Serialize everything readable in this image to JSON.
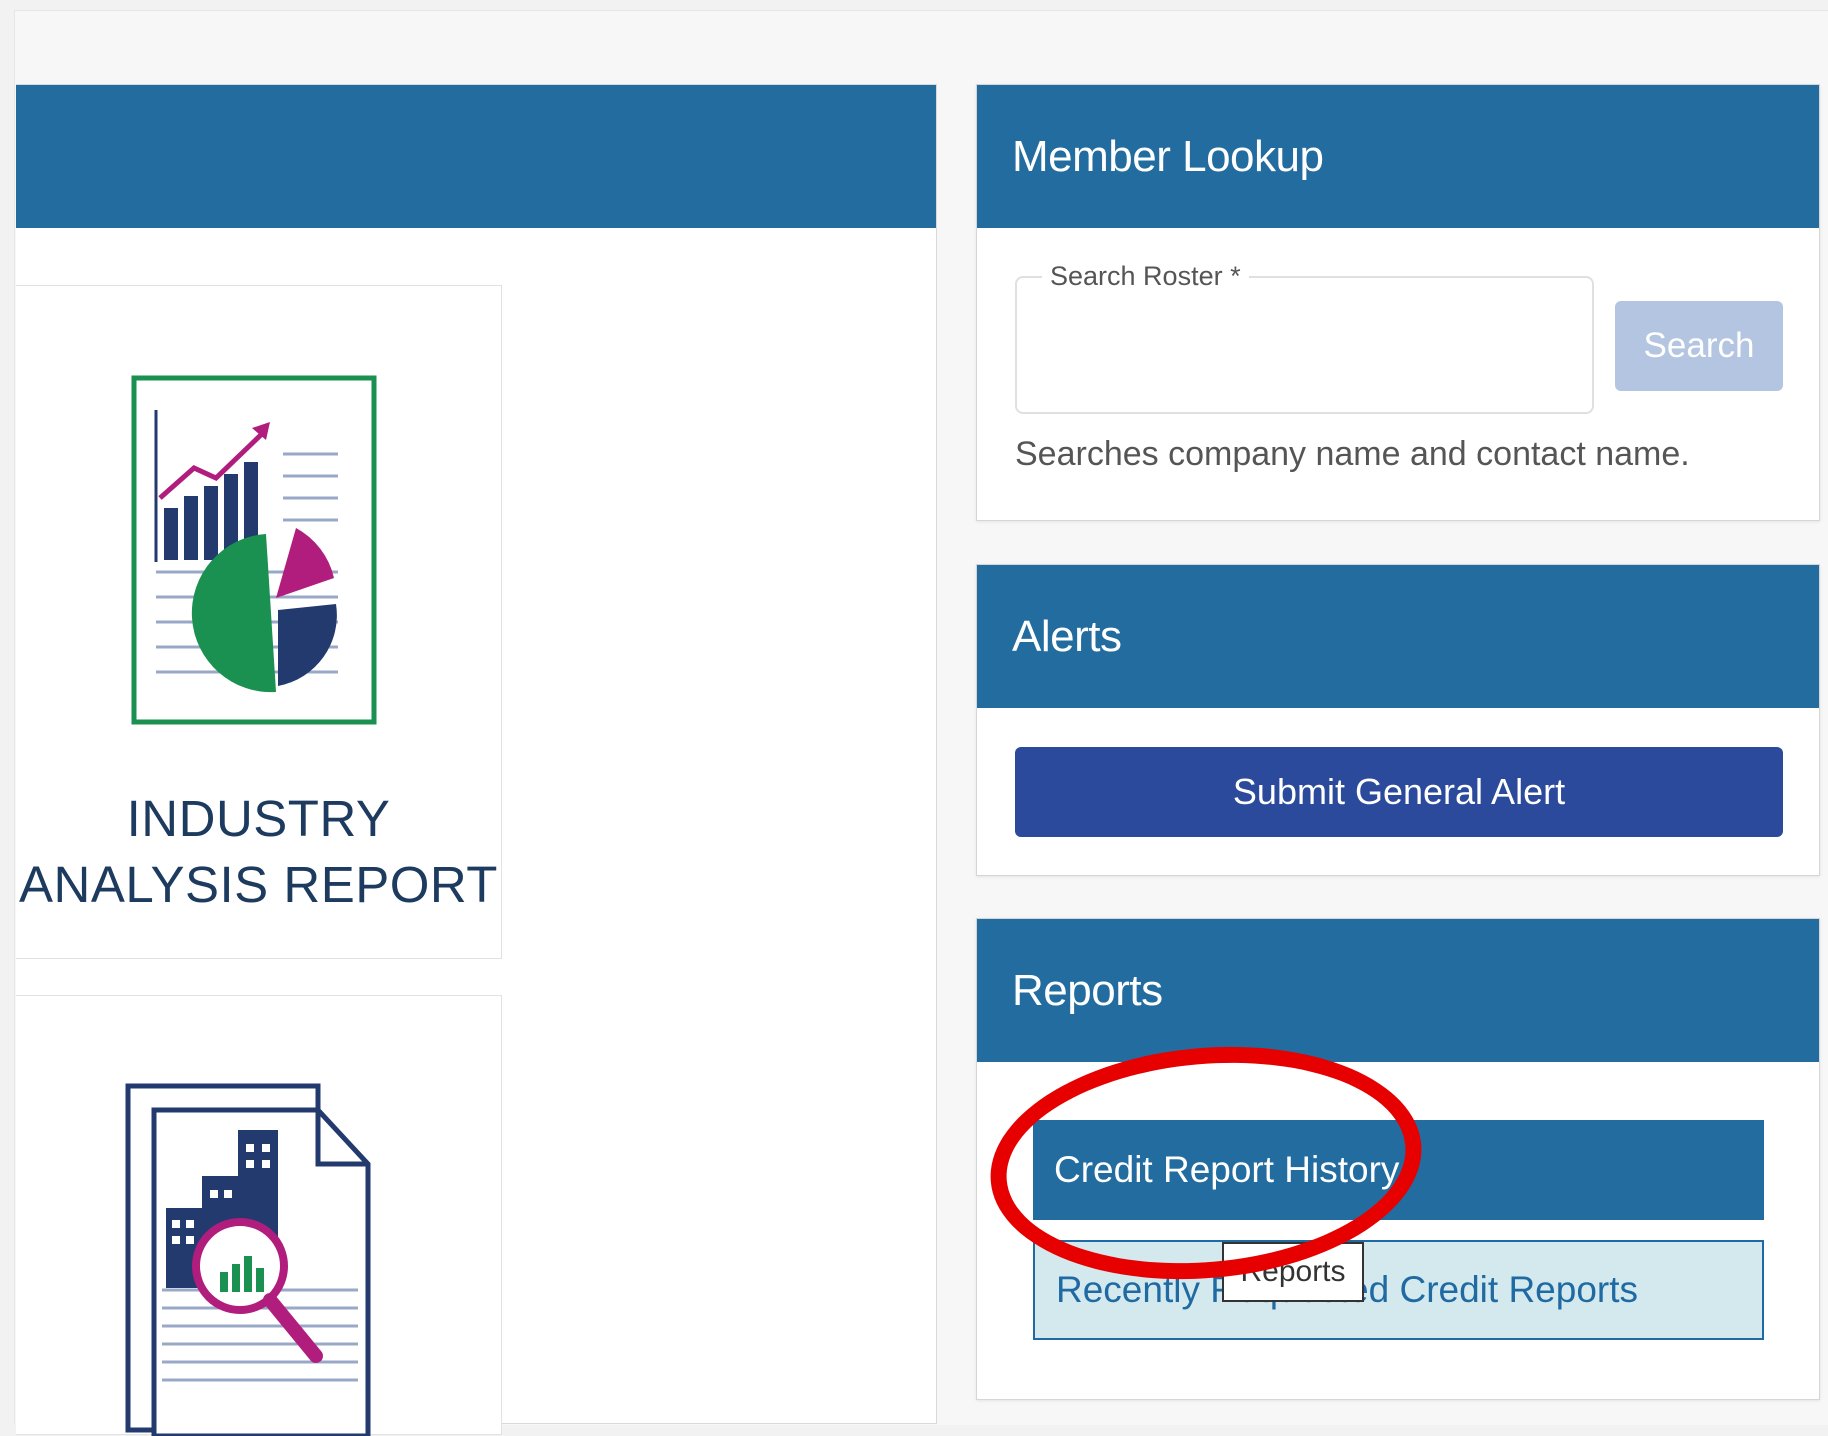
{
  "member_lookup": {
    "title": "Member Lookup",
    "field_label": "Search Roster *",
    "field_value": "",
    "search_button": "Search",
    "helper": "Searches company name and contact name."
  },
  "alerts": {
    "title": "Alerts",
    "submit_button": "Submit General Alert"
  },
  "reports": {
    "title": "Reports",
    "items": [
      {
        "label": "Credit Report History"
      },
      {
        "label": "Recently Requested Credit Reports"
      }
    ],
    "tooltip": "Reports"
  },
  "tiles": [
    {
      "label_line1": "INDUSTRY",
      "label_line2": "ANALYSIS REPORT",
      "icon": "report-chart-icon"
    },
    {
      "icon": "company-search-report-icon"
    }
  ],
  "colors": {
    "header_blue": "#236ca0",
    "button_navy": "#2b4a9c",
    "button_disabled": "#b3c5e1",
    "highlight_red": "#e60000"
  }
}
